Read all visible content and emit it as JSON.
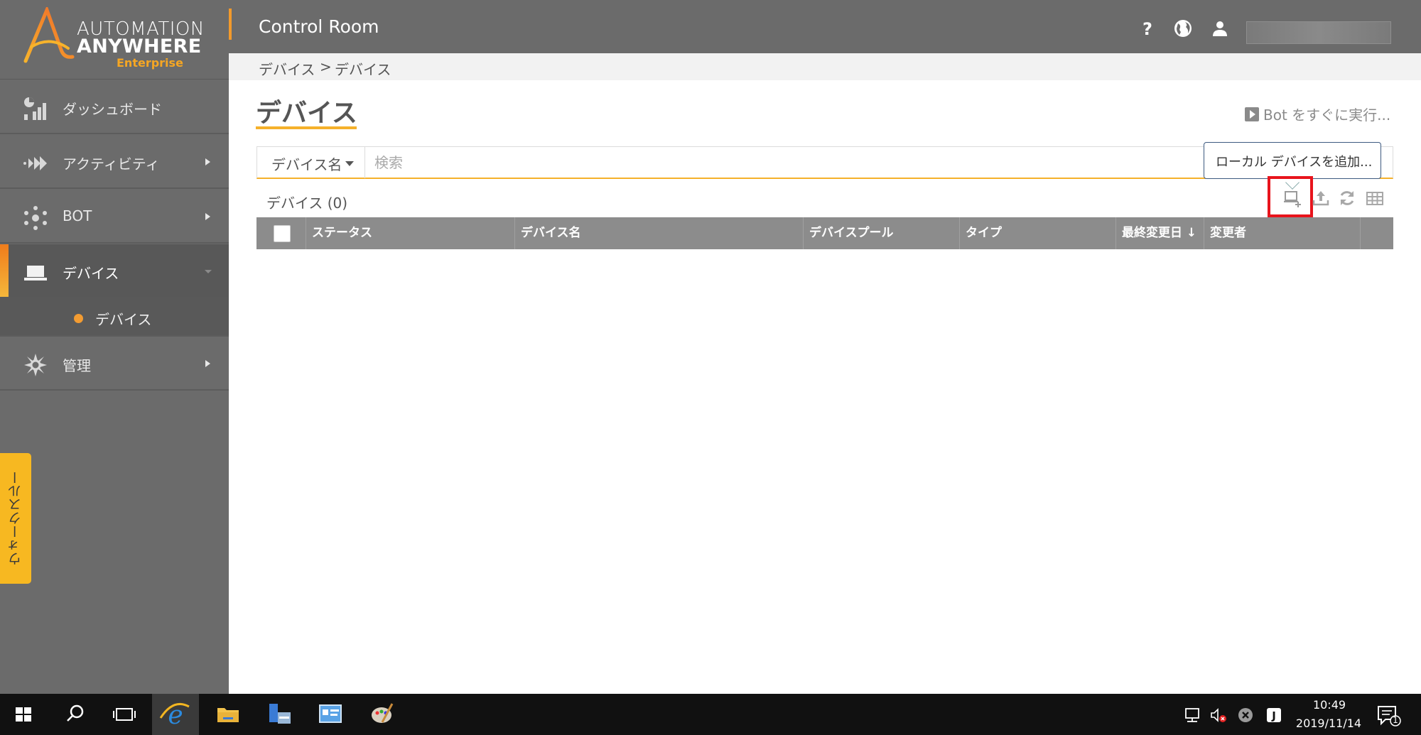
{
  "logo": {
    "line1": "AUTOMATION",
    "line2": "ANYWHERE",
    "line3": "Enterprise"
  },
  "sidebar": {
    "items": [
      {
        "label": "ダッシュボード",
        "icon": "dashboard-icon"
      },
      {
        "label": "アクティビティ",
        "icon": "activity-icon"
      },
      {
        "label": "BOT",
        "icon": "bot-icon"
      },
      {
        "label": "デバイス",
        "icon": "laptop-icon"
      },
      {
        "label": "管理",
        "icon": "settings-icon"
      }
    ],
    "sub_item": "デバイス",
    "walkthrough": "ウォークスルー"
  },
  "header": {
    "title": "Control Room"
  },
  "breadcrumb": {
    "part1": "デバイス",
    "sep": ">",
    "part2": "デバイス"
  },
  "main": {
    "title": "デバイス",
    "run_bot": "Bot をすぐに実行...",
    "filter_label": "デバイス名",
    "search_placeholder": "検索",
    "tooltip": "ローカル デバイスを追加...",
    "count_label": "デバイス (0)",
    "columns": [
      "ステータス",
      "デバイス名",
      "デバイスプール",
      "タイプ",
      "最終変更日 ↓",
      "変更者"
    ]
  },
  "taskbar": {
    "time": "10:49",
    "date": "2019/11/14",
    "notifications": "1"
  },
  "colors": {
    "accent": "#f5b12b",
    "sidebar": "#6b6b6b",
    "highlight": "#e8141c"
  }
}
